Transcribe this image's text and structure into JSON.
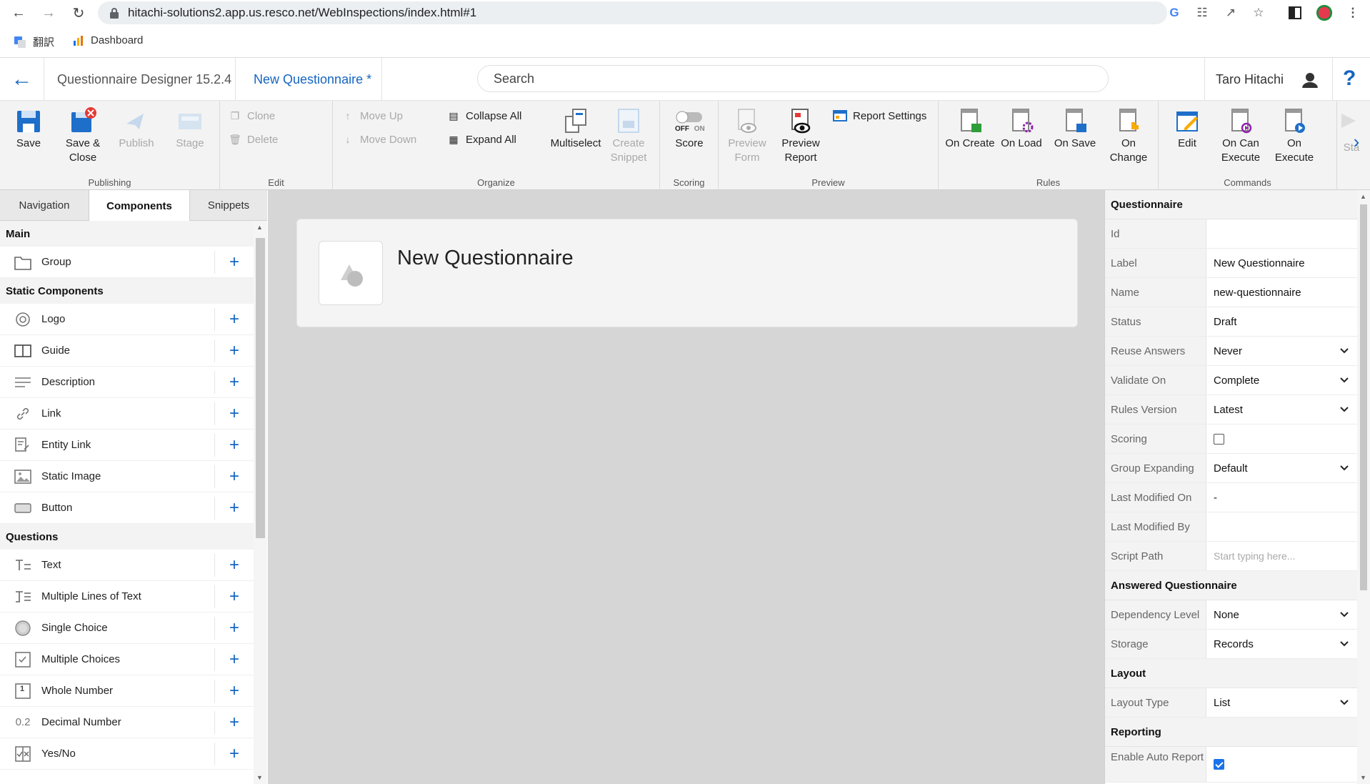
{
  "browser": {
    "url": "hitachi-solutions2.app.us.resco.net/WebInspections/index.html#1",
    "bookmarks": [
      {
        "label": "翻訳",
        "icon": "google-translate-icon"
      },
      {
        "label": "Dashboard",
        "icon": "dashboard-icon"
      }
    ]
  },
  "header": {
    "designer_title": "Questionnaire Designer 15.2.4",
    "questionnaire_tab": "New Questionnaire *",
    "search_placeholder": "Search",
    "user_name": "Taro Hitachi",
    "help_label": "?"
  },
  "ribbon": {
    "publishing": {
      "label": "Publishing",
      "save": "Save",
      "save_close_1": "Save &",
      "save_close_2": "Close",
      "publish": "Publish",
      "stage": "Stage"
    },
    "edit": {
      "label": "Edit",
      "clone": "Clone",
      "delete": "Delete"
    },
    "organize": {
      "label": "Organize",
      "move_up": "Move Up",
      "move_down": "Move Down",
      "collapse_all": "Collapse All",
      "expand_all": "Expand All",
      "multiselect": "Multiselect",
      "create_snippet_1": "Create",
      "create_snippet_2": "Snippet"
    },
    "scoring": {
      "label": "Scoring",
      "score": "Score",
      "off": "OFF",
      "on": "ON"
    },
    "preview": {
      "label": "Preview",
      "preview_form_1": "Preview",
      "preview_form_2": "Form",
      "preview_report_1": "Preview",
      "preview_report_2": "Report",
      "report_settings": "Report Settings"
    },
    "rules": {
      "label": "Rules",
      "on_create": "On Create",
      "on_load": "On Load",
      "on_save": "On Save",
      "on_change_1": "On",
      "on_change_2": "Change"
    },
    "commands": {
      "label": "Commands",
      "edit": "Edit",
      "on_can_execute_1": "On Can",
      "on_can_execute_2": "Execute",
      "on_execute_1": "On",
      "on_execute_2": "Execute",
      "sta": "Sta"
    }
  },
  "left_panel": {
    "tabs": [
      "Navigation",
      "Components",
      "Snippets"
    ],
    "active_tab": "Components",
    "sections": [
      {
        "title": "Main",
        "items": [
          {
            "label": "Group",
            "icon": "folder-icon"
          }
        ]
      },
      {
        "title": "Static Components",
        "items": [
          {
            "label": "Logo",
            "icon": "logo-icon"
          },
          {
            "label": "Guide",
            "icon": "book-icon"
          },
          {
            "label": "Description",
            "icon": "lines-icon"
          },
          {
            "label": "Link",
            "icon": "link-icon"
          },
          {
            "label": "Entity Link",
            "icon": "entity-link-icon"
          },
          {
            "label": "Static Image",
            "icon": "image-icon"
          },
          {
            "label": "Button",
            "icon": "button-icon"
          }
        ]
      },
      {
        "title": "Questions",
        "items": [
          {
            "label": "Text",
            "icon": "text-icon"
          },
          {
            "label": "Multiple Lines of Text",
            "icon": "multiline-text-icon"
          },
          {
            "label": "Single Choice",
            "icon": "radio-icon"
          },
          {
            "label": "Multiple Choices",
            "icon": "checkbox-icon"
          },
          {
            "label": "Whole Number",
            "icon": "number-icon",
            "glyph": "1"
          },
          {
            "label": "Decimal Number",
            "icon": "decimal-icon",
            "glyph": "0.2"
          },
          {
            "label": "Yes/No",
            "icon": "yes-no-icon"
          }
        ]
      }
    ]
  },
  "canvas": {
    "title": "New Questionnaire"
  },
  "properties": {
    "sections": [
      {
        "title": "Questionnaire",
        "rows": [
          {
            "label": "Id",
            "value": "",
            "type": "text"
          },
          {
            "label": "Label",
            "value": "New Questionnaire",
            "type": "text"
          },
          {
            "label": "Name",
            "value": "new-questionnaire",
            "type": "text"
          },
          {
            "label": "Status",
            "value": "Draft",
            "type": "text"
          },
          {
            "label": "Reuse Answers",
            "value": "Never",
            "type": "select"
          },
          {
            "label": "Validate On",
            "value": "Complete",
            "type": "select"
          },
          {
            "label": "Rules Version",
            "value": "Latest",
            "type": "select"
          },
          {
            "label": "Scoring",
            "value": false,
            "type": "checkbox"
          },
          {
            "label": "Group Expanding",
            "value": "Default",
            "type": "select"
          },
          {
            "label": "Last Modified On",
            "value": "-",
            "type": "text"
          },
          {
            "label": "Last Modified By",
            "value": "",
            "type": "text"
          },
          {
            "label": "Script Path",
            "value": "",
            "placeholder": "Start typing here...",
            "type": "input"
          }
        ]
      },
      {
        "title": "Answered Questionnaire",
        "rows": [
          {
            "label": "Dependency Level",
            "value": "None",
            "type": "select"
          },
          {
            "label": "Storage",
            "value": "Records",
            "type": "select"
          }
        ]
      },
      {
        "title": "Layout",
        "rows": [
          {
            "label": "Layout Type",
            "value": "List",
            "type": "select"
          }
        ]
      },
      {
        "title": "Reporting",
        "rows": [
          {
            "label": "Enable Auto Report",
            "value": true,
            "type": "checkbox"
          }
        ]
      }
    ]
  },
  "colors": {
    "accent": "#1565c0",
    "ribbon_bg": "#f3f3f3",
    "canvas_bg": "#d6d6d6"
  }
}
